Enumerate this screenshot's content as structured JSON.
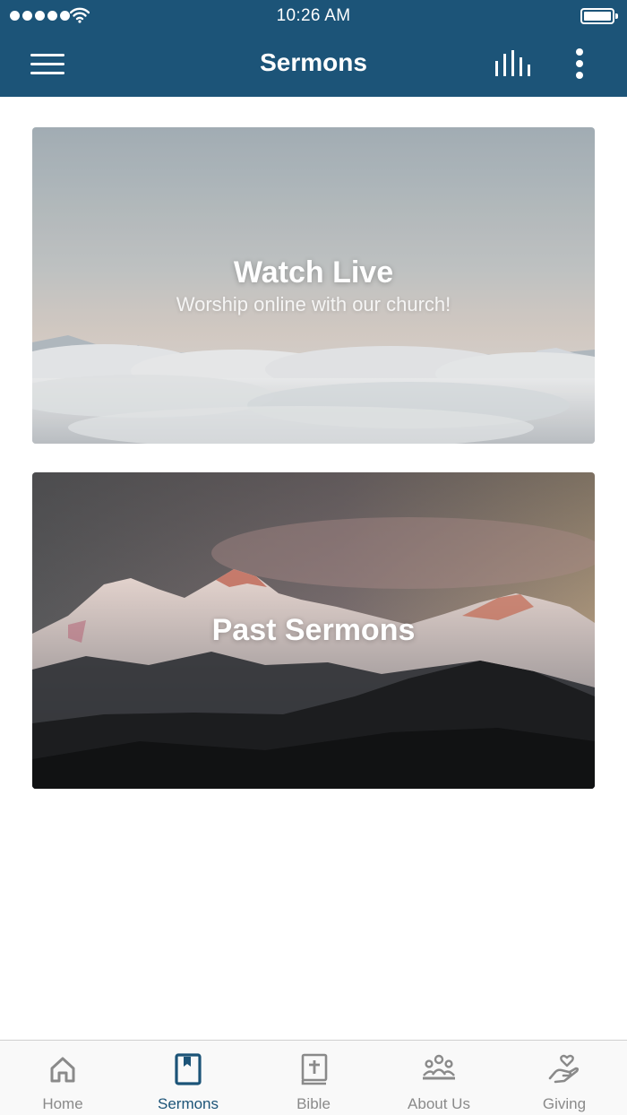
{
  "status_bar": {
    "time": "10:26 AM",
    "signal_bars": 5
  },
  "nav": {
    "title": "Sermons",
    "menu_icon": "hamburger-icon",
    "audio_icon": "audio-bars-icon",
    "more_icon": "more-vertical-icon"
  },
  "cards": [
    {
      "title": "Watch Live",
      "subtitle": "Worship online with our church!"
    },
    {
      "title": "Past Sermons"
    }
  ],
  "tabs": [
    {
      "label": "Home",
      "icon": "home-icon",
      "active": false
    },
    {
      "label": "Sermons",
      "icon": "bookmark-book-icon",
      "active": true
    },
    {
      "label": "Bible",
      "icon": "bible-icon",
      "active": false
    },
    {
      "label": "About Us",
      "icon": "people-icon",
      "active": false
    },
    {
      "label": "Giving",
      "icon": "giving-hand-icon",
      "active": false
    }
  ],
  "colors": {
    "primary": "#1c5478",
    "tab_inactive": "#8a8a8a",
    "tab_active": "#1c5478"
  }
}
